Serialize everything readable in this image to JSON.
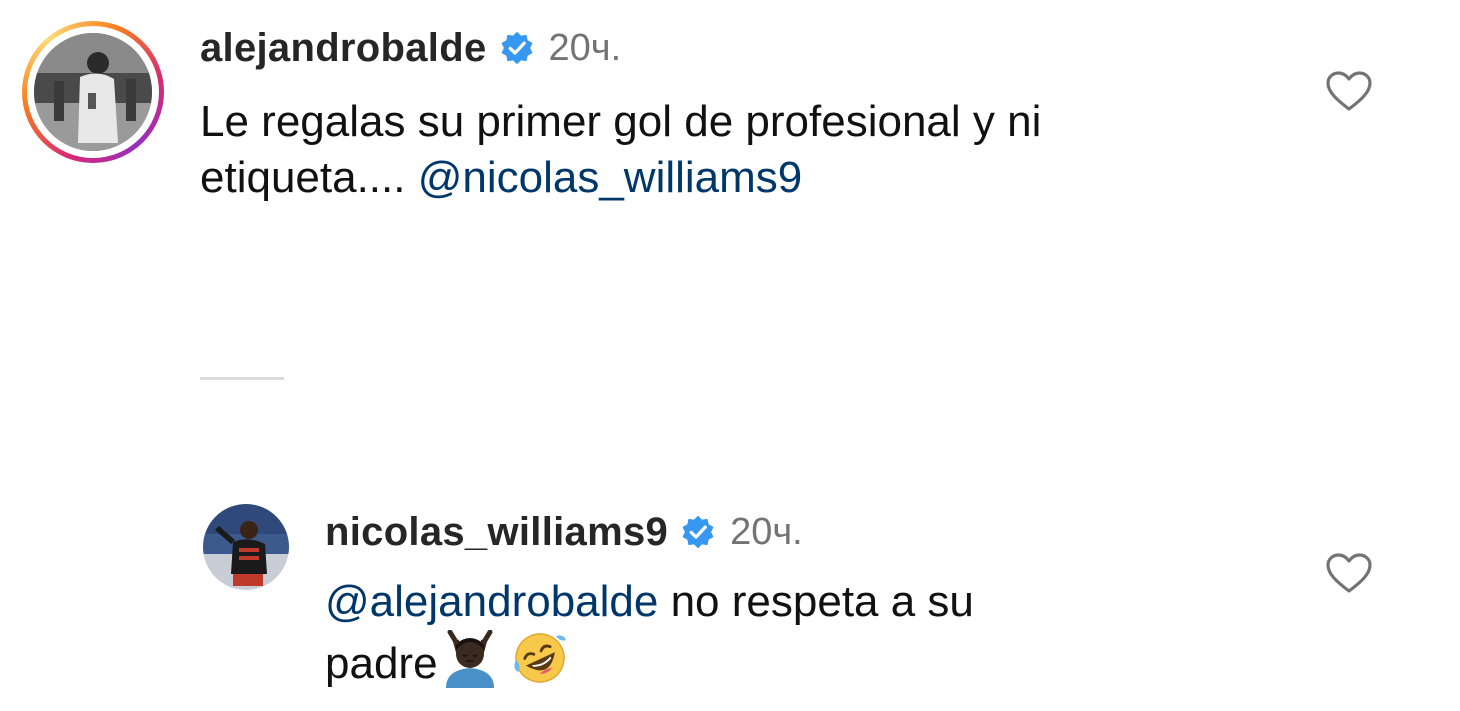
{
  "comments": [
    {
      "username": "alejandrobalde",
      "time": "20ч.",
      "text_line1": "Le regalas su primer gol de profesional y ni",
      "text_line2_prefix": "etiqueta.... ",
      "mention": "@nicolas_williams9",
      "avatar": "alejandrobalde-avatar",
      "has_story_ring": true
    },
    {
      "username": "nicolas_williams9",
      "time": "20ч.",
      "mention": "@alejandrobalde",
      "text_line1_suffix": " no respeta a su",
      "text_line2": "padre",
      "emojis": [
        "person-gesturing-no-emoji",
        "rolling-on-floor-laughing-emoji"
      ],
      "avatar": "nicolas-williams9-avatar",
      "has_story_ring": false
    }
  ],
  "icons": {
    "verified": "verified-badge-icon",
    "like": "heart-icon"
  },
  "colors": {
    "verified": "#3897f0",
    "mention": "#00376b",
    "time": "#737373",
    "divider": "#dbdbdb"
  }
}
